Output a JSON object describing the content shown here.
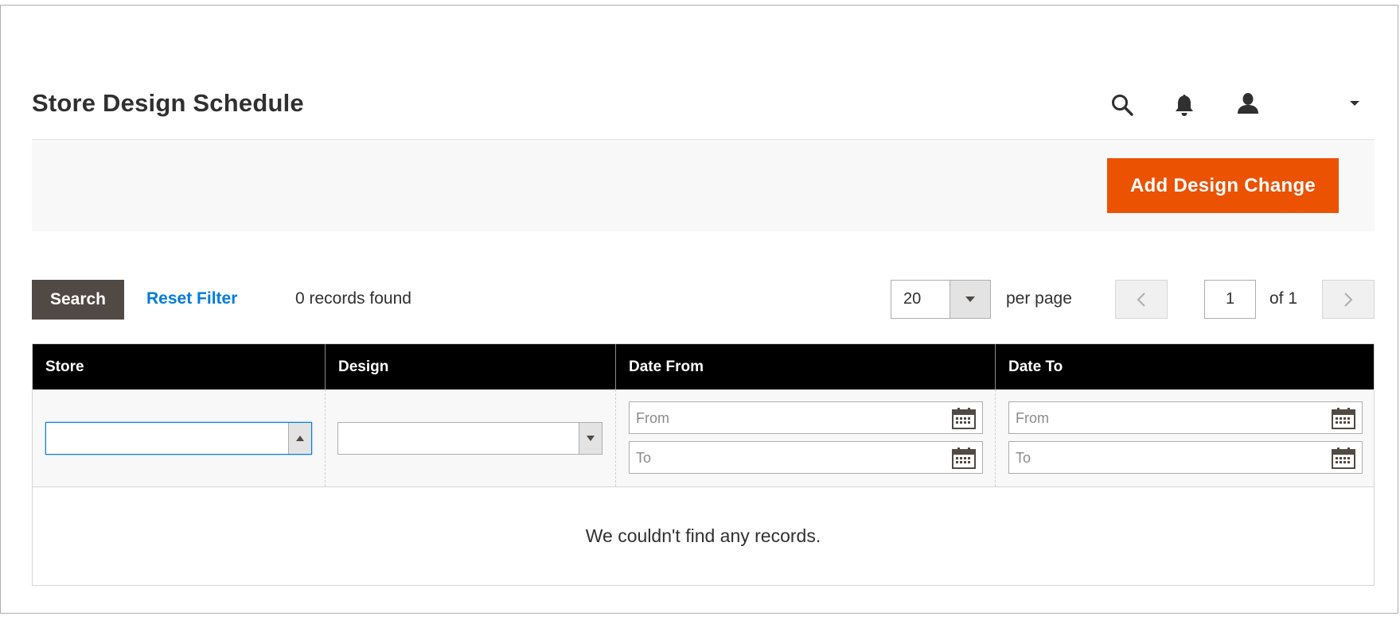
{
  "page": {
    "title": "Store Design Schedule"
  },
  "header": {
    "icons": [
      "search-icon",
      "bell-icon",
      "user-icon",
      "caret-down-icon"
    ]
  },
  "actions": {
    "add_label": "Add Design Change",
    "accent_color": "#eb5202"
  },
  "toolbar": {
    "search_label": "Search",
    "reset_label": "Reset Filter",
    "records_found": "0 records found",
    "per_page_value": "20",
    "per_page_label": "per page",
    "current_page": "1",
    "total_pages": "of 1"
  },
  "grid": {
    "columns": [
      "Store",
      "Design",
      "Date From",
      "Date To"
    ],
    "filters": {
      "date_from": {
        "from_placeholder": "From",
        "to_placeholder": "To"
      },
      "date_to": {
        "from_placeholder": "From",
        "to_placeholder": "To"
      }
    },
    "empty_message": "We couldn't find any records."
  }
}
